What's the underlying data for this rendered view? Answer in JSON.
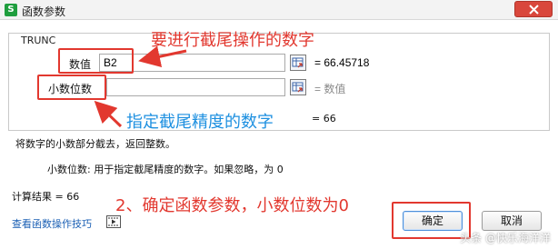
{
  "window": {
    "title": "函数参数",
    "app_icon": "S",
    "close_icon": "close-x"
  },
  "function": {
    "name": "TRUNC",
    "arguments": [
      {
        "label": "数值",
        "value": "B2",
        "result": "= 66.45718",
        "ref_icon": "range-select-icon"
      },
      {
        "label": "小数位数",
        "value": "",
        "result": "= 数值",
        "ref_icon": "range-select-icon"
      }
    ],
    "formula_result": "= 66",
    "description": "将数字的小数部分截去，返回整数。",
    "param_description": "小数位数:  用于指定截尾精度的数字。如果忽略，为 0"
  },
  "footer": {
    "calc_result": "计算结果  =  66",
    "help_link": "查看函数操作技巧",
    "help_icon": "video-icon",
    "ok_label": "确定",
    "cancel_label": "取消"
  },
  "annotations": {
    "top": "要进行截尾操作的数字",
    "middle": "指定截尾精度的数字",
    "bottom": "2、确定函数参数，小数位数为0"
  },
  "watermark": "头条 @快乐海洋洋",
  "colors": {
    "annotation_red": "#e2382f",
    "annotation_blue": "#1e90e0",
    "link_blue": "#1a5fb4",
    "close_red": "#d9473c",
    "app_green": "#1f9e3e"
  }
}
